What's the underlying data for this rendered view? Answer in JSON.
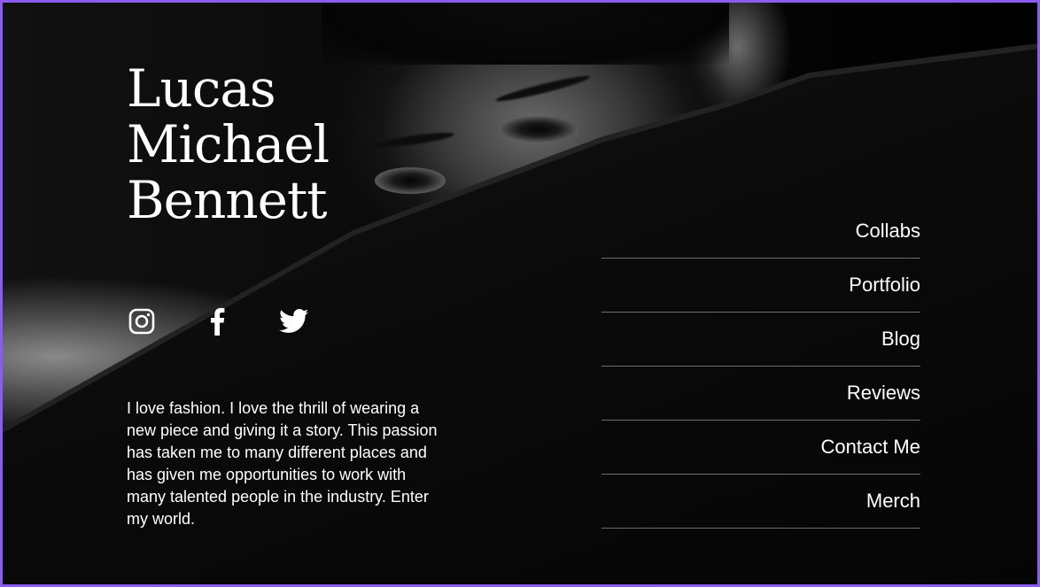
{
  "profile": {
    "name_lines": [
      "Lucas",
      "Michael",
      "Bennett"
    ],
    "bio": "I love fashion. I love the thrill of wearing a new piece and giving it a story. This passion has taken me to many different places and has given me opportunities to work with many talented people in the industry. Enter my world."
  },
  "social": {
    "icons": [
      "instagram-icon",
      "facebook-icon",
      "twitter-icon"
    ]
  },
  "nav": {
    "items": [
      {
        "label": "Collabs"
      },
      {
        "label": "Portfolio"
      },
      {
        "label": "Blog"
      },
      {
        "label": "Reviews"
      },
      {
        "label": "Contact Me"
      },
      {
        "label": "Merch"
      }
    ]
  },
  "colors": {
    "background": "#000000",
    "text": "#ffffff",
    "divider": "#6e6e6e",
    "frame_border": "#8a5cf0"
  }
}
